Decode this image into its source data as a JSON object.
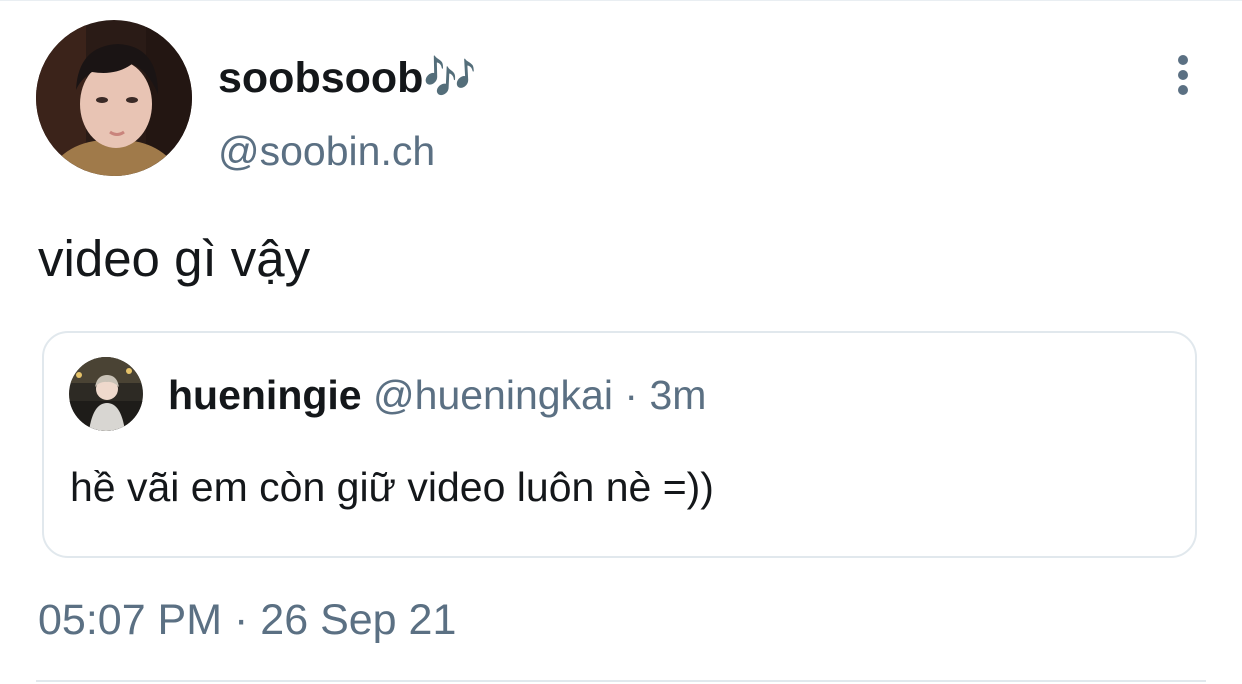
{
  "tweet": {
    "author": {
      "display_name": "soobsoob🎶",
      "handle": "@soobin.ch"
    },
    "text": "video gì vậy",
    "timestamp": {
      "time": "05:07 PM",
      "separator": "·",
      "date": "26 Sep 21"
    }
  },
  "quoted_tweet": {
    "author": {
      "display_name": "hueningie",
      "handle": "@hueningkai"
    },
    "separator": "·",
    "relative_time": "3m",
    "text": "hề vãi em còn giữ video luôn nè =))"
  },
  "icons": {
    "more": "more-vertical-icon"
  },
  "colors": {
    "primary_text": "#14171a",
    "secondary_text": "#5b7083",
    "border": "#e1e8ed"
  }
}
